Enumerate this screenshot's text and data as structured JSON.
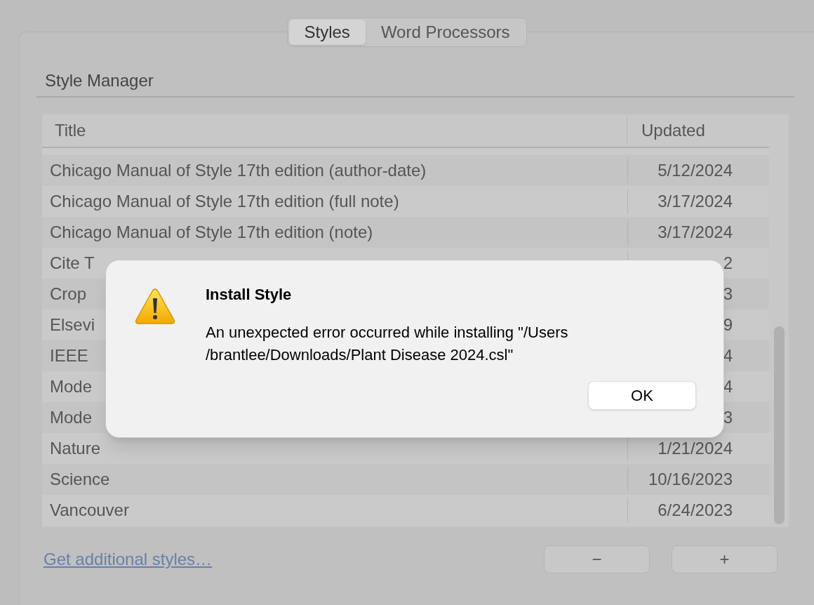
{
  "tabs": [
    {
      "label": "Styles",
      "selected": true
    },
    {
      "label": "Word Processors",
      "selected": false
    }
  ],
  "section_title": "Style Manager",
  "table": {
    "columns": [
      "Title",
      "Updated"
    ],
    "rows": [
      {
        "title": "Chicago Manual of Style 17th edition (author-date)",
        "updated": "5/12/2024"
      },
      {
        "title": "Chicago Manual of Style 17th edition (full note)",
        "updated": "3/17/2024"
      },
      {
        "title": "Chicago Manual of Style 17th edition (note)",
        "updated": "3/17/2024"
      },
      {
        "title": "Cite T",
        "updated": "2"
      },
      {
        "title": "Crop",
        "updated": "3"
      },
      {
        "title": "Elsevi",
        "updated": "9"
      },
      {
        "title": "IEEE",
        "updated": "4"
      },
      {
        "title": "Mode",
        "updated": "4"
      },
      {
        "title": "Mode",
        "updated": "3"
      },
      {
        "title": "Nature",
        "updated": "1/21/2024"
      },
      {
        "title": "Science",
        "updated": "10/16/2023"
      },
      {
        "title": "Vancouver",
        "updated": "6/24/2023"
      }
    ]
  },
  "link": "Get additional styles…",
  "buttons": [
    "−",
    "+"
  ],
  "dialog": {
    "title": "Install Style",
    "message_lines": [
      "An unexpected error occurred while installing \"/Users",
      "/brantlee/Downloads/Plant Disease 2024.csl\""
    ],
    "button": "OK"
  }
}
